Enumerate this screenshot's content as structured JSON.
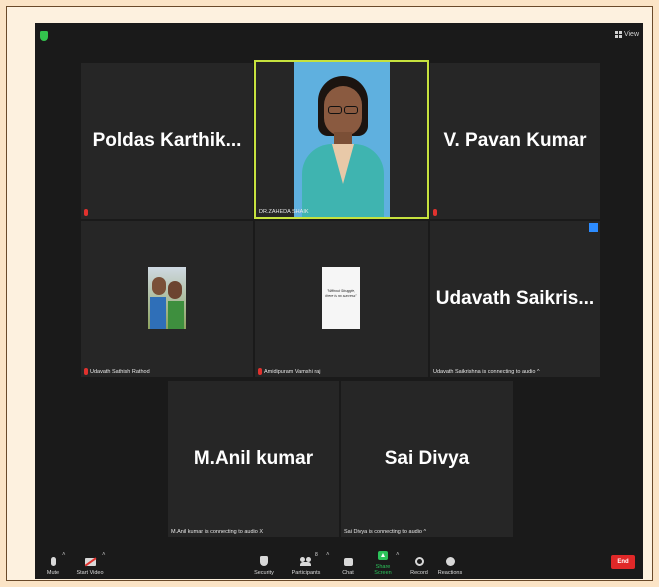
{
  "header": {
    "view_label": "View"
  },
  "tiles": [
    {
      "id": "poldas",
      "name": "Poldas  Karthik..."
    },
    {
      "id": "dr-zaheda",
      "caption": "DR.ZAHEDA SHAIK"
    },
    {
      "id": "pavan",
      "name": "V. Pavan Kumar"
    },
    {
      "id": "sathish",
      "caption": "Udavath Sathish Rathod"
    },
    {
      "id": "vamshi",
      "caption": "Amidipuram Vamshi raj",
      "quote": "\"Without Struggle, there is no success\""
    },
    {
      "id": "saikrishna",
      "name": "Udavath  Saikris...",
      "caption": "Udavath Saikrishna is connecting to audio ^"
    },
    {
      "id": "anil",
      "name": "M.Anil kumar",
      "caption": "M.Anil kumar is connecting to audio X"
    },
    {
      "id": "divya",
      "name": "Sai Divya",
      "caption": "Sai Divya is connecting to audio ^"
    }
  ],
  "toolbar": {
    "mute": "Mute",
    "start_video": "Start Video",
    "security": "Security",
    "participants": "Participants",
    "participants_count": "8",
    "chat": "Chat",
    "share_screen": "Share Screen",
    "record": "Record",
    "reactions": "Reactions",
    "end": "End"
  },
  "colors": {
    "active_speaker_border": "#c6e23e",
    "share_green": "#2cc35a",
    "end_red": "#e02828",
    "muted_red": "#e0322e"
  }
}
